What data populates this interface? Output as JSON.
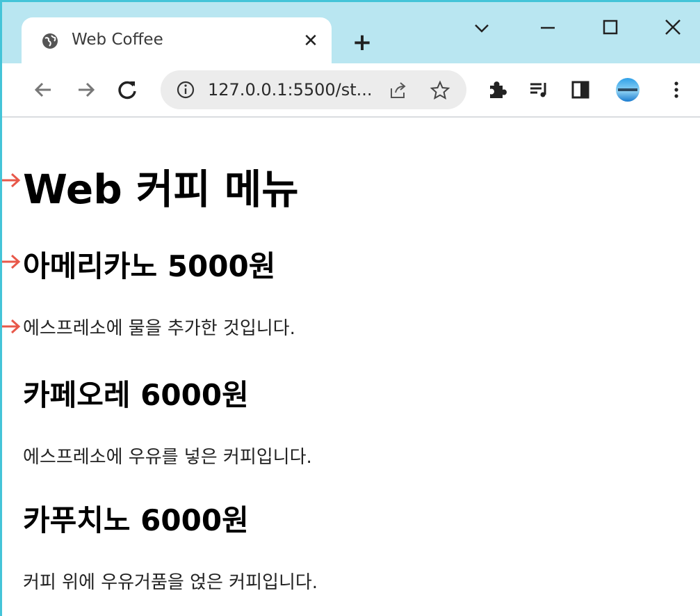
{
  "browser": {
    "tab": {
      "title": "Web Coffee",
      "close_label": "✕"
    },
    "new_tab_label": "+",
    "address": {
      "url": "127.0.0.1:5500/st..."
    },
    "window_controls": [
      "chevron-down",
      "minimize",
      "maximize",
      "close"
    ],
    "toolbar_icons": [
      "back-arrow",
      "forward-arrow",
      "reload",
      "info",
      "share",
      "star",
      "extensions-puzzle",
      "reading-list",
      "side-panel",
      "profile-avatar",
      "more-menu"
    ]
  },
  "page": {
    "heading": "Web 커피 메뉴",
    "items": [
      {
        "name": "아메리카노 5000원",
        "description": "에스프레소에 물을 추가한 것입니다."
      },
      {
        "name": "카페오레 6000원",
        "description": "에스프레소에 우유를 넣은 커피입니다."
      },
      {
        "name": "카푸치노 6000원",
        "description": "커피 위에 우유거품을 얹은 커피입니다."
      }
    ]
  },
  "colors": {
    "titlebar": "#b9e6f1",
    "frame_accent": "#44c4d8",
    "annotation_arrow": "#e8584a"
  }
}
